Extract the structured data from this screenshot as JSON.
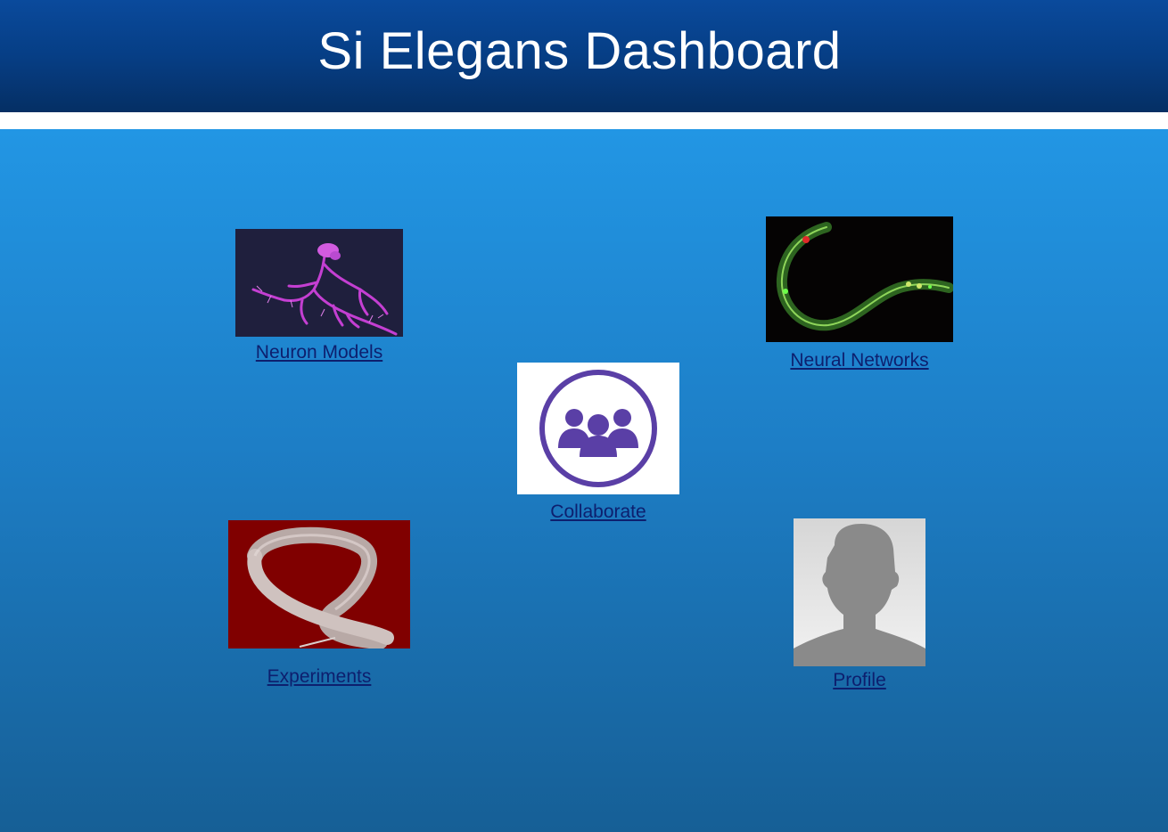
{
  "header": {
    "title": "Si Elegans Dashboard"
  },
  "tiles": {
    "neuron_models": {
      "label": "Neuron Models",
      "image": "neuron-image"
    },
    "neural_networks": {
      "label": "Neural Networks",
      "image": "worm-fluorescence-image"
    },
    "collaborate": {
      "label": "Collaborate",
      "image": "group-icon"
    },
    "experiments": {
      "label": "Experiments",
      "image": "worm-micrograph-image"
    },
    "profile": {
      "label": "Profile",
      "image": "avatar-placeholder-image"
    }
  },
  "colors": {
    "header_dark": "#052f64",
    "header_light": "#0a4a9c",
    "content_top": "#2296e4",
    "content_bottom": "#165f96",
    "link": "#0d1f6e",
    "collaborate_purple": "#5a3fa6"
  }
}
